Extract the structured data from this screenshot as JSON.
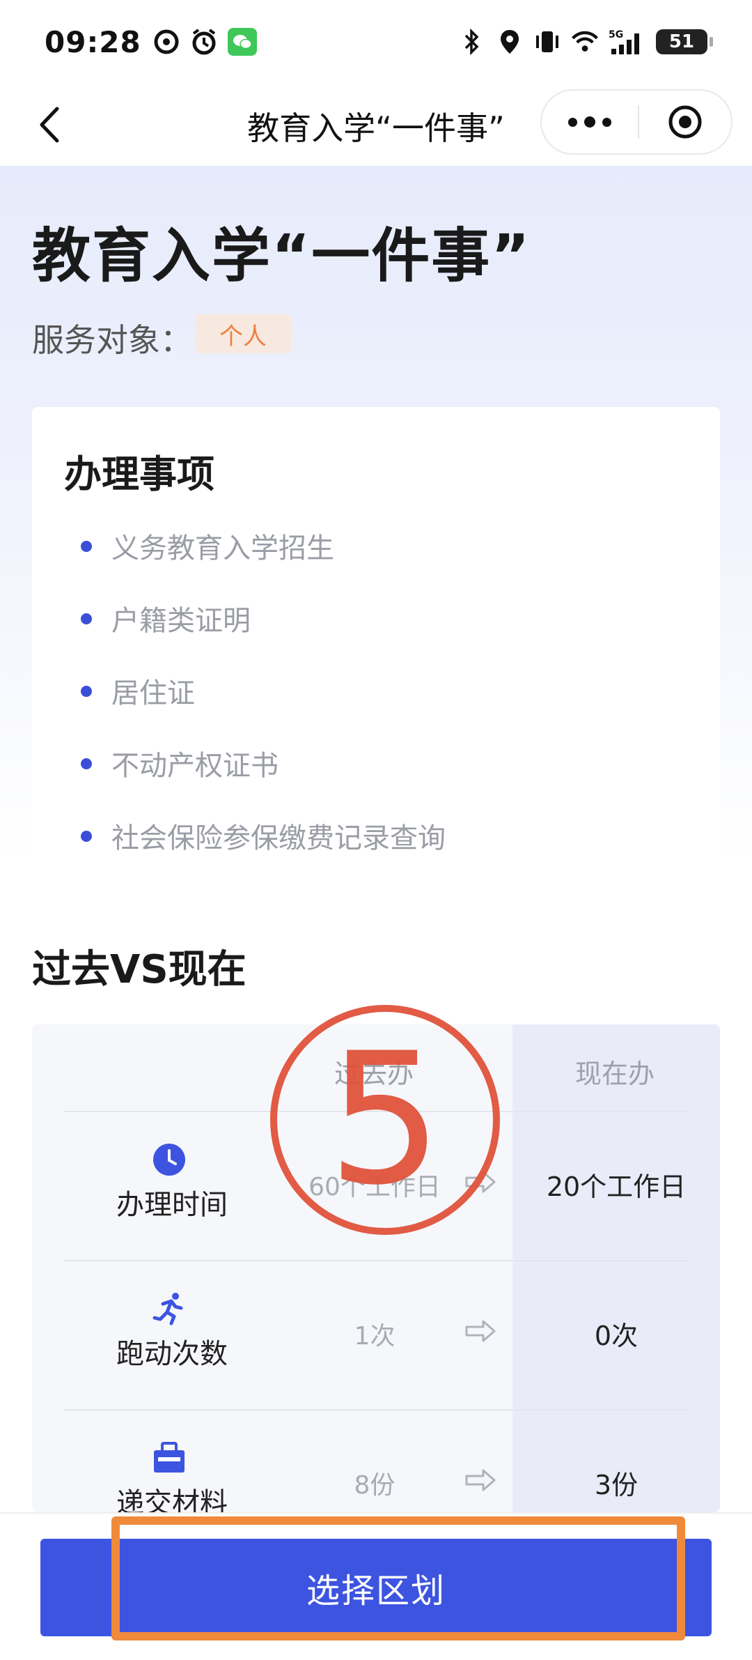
{
  "status_bar": {
    "time": "09:28",
    "battery": "51"
  },
  "nav": {
    "title": "教育入学“一件事”"
  },
  "hero": {
    "title": "教育入学“一件事”",
    "service_label": "服务对象：",
    "service_badge": "个人"
  },
  "items_card": {
    "title": "办理事项",
    "items": [
      "义务教育入学招生",
      "户籍类证明",
      "居住证",
      "不动产权证书",
      "社会保险参保缴费记录查询"
    ]
  },
  "compare": {
    "title": "过去VS现在",
    "header_past": "过去办",
    "header_now": "现在办",
    "rows": [
      {
        "icon": "clock-icon",
        "label": "办理时间",
        "past": "60个工作日",
        "now": "20个工作日"
      },
      {
        "icon": "running-icon",
        "label": "跑动次数",
        "past": "1次",
        "now": "0次"
      },
      {
        "icon": "briefcase-icon",
        "label": "递交材料",
        "past": "8份",
        "now": "3份"
      }
    ]
  },
  "watermark": "5",
  "bottom": {
    "button_label": "选择区划"
  },
  "colors": {
    "primary": "#3d54e0",
    "badge_text": "#ee8040",
    "watermark": "#e0533c",
    "highlight": "#ef8a3a"
  }
}
